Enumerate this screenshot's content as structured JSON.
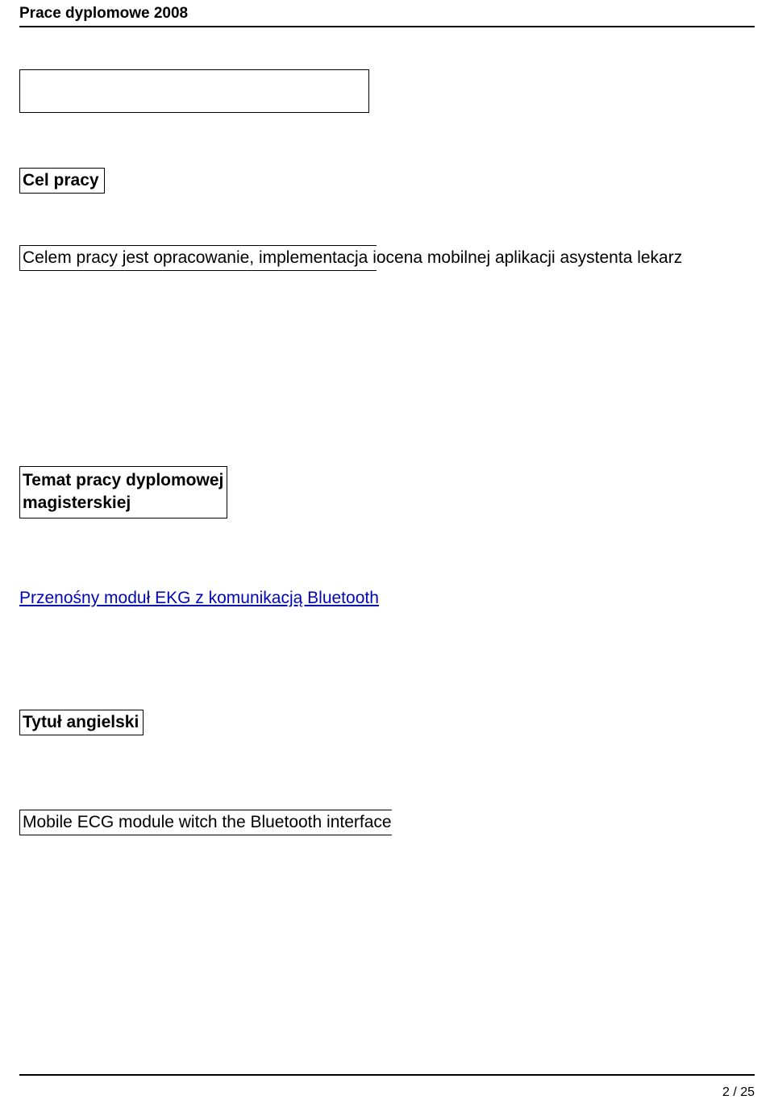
{
  "header": {
    "title": "Prace dyplomowe 2008"
  },
  "sections": {
    "cel_pracy_label": "Cel pracy",
    "cel_pracy_boxed": "Celem pracy jest opracowanie, implementacja i ",
    "cel_pracy_overflow": "ocena mobilnej aplikacji asystenta lekarz",
    "temat_label_line1": "Temat pracy dyplomowej",
    "temat_label_line2": "magisterskiej",
    "link_text": "Przenośny moduł EKG z komunikacją Bluetooth",
    "tytul_angielski_label": "Tytuł angielski",
    "english_title_text": "Mobile ECG module witch the Bluetooth interface"
  },
  "footer": {
    "page_number": "2 / 25"
  }
}
